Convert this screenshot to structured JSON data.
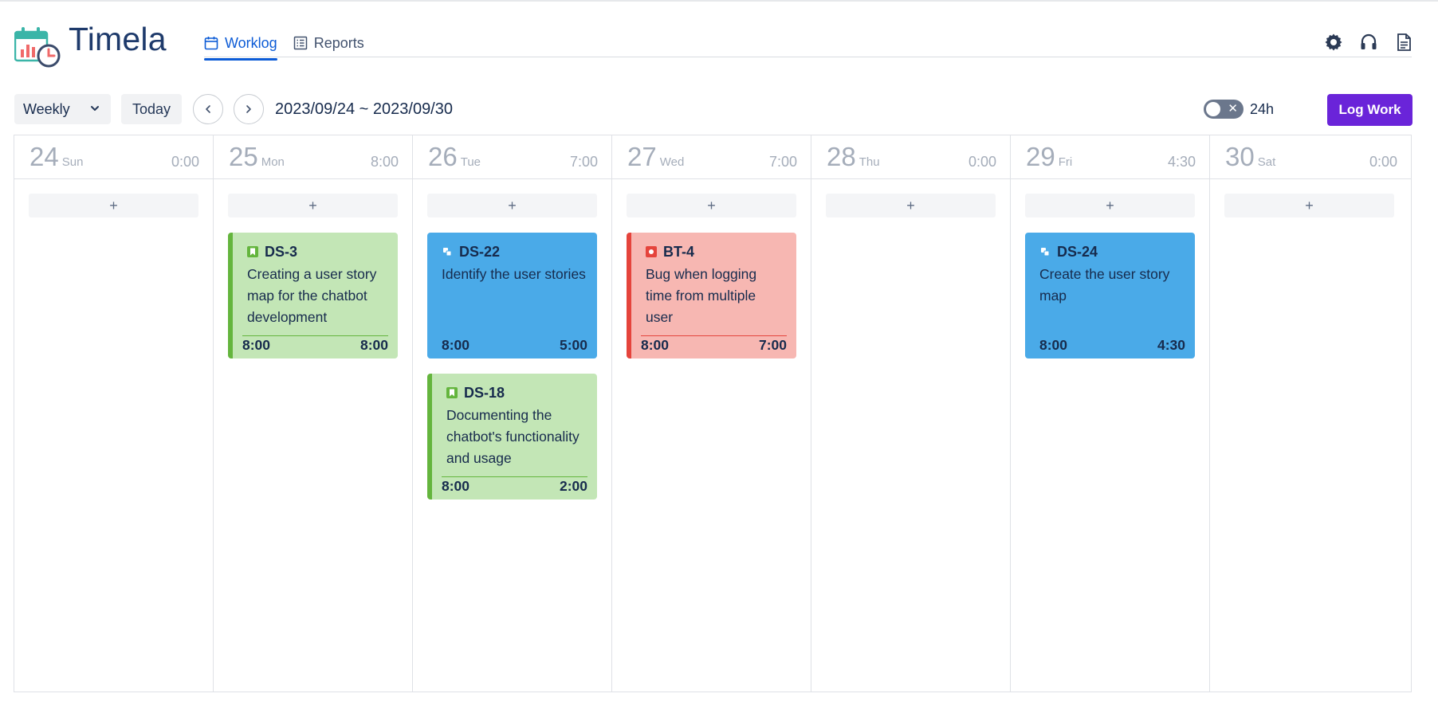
{
  "app": {
    "name": "Timela"
  },
  "nav": {
    "tabs": [
      {
        "label": "Worklog",
        "icon": "calendar-icon",
        "active": true
      },
      {
        "label": "Reports",
        "icon": "report-list-icon",
        "active": false
      }
    ]
  },
  "header_icons": [
    "gear-icon",
    "headset-icon",
    "document-icon"
  ],
  "toolbar": {
    "view_select": "Weekly",
    "today_label": "Today",
    "range": "2023/09/24 ~ 2023/09/30",
    "toggle_label": "24h",
    "toggle_on": false,
    "log_work_label": "Log Work"
  },
  "colors": {
    "accent": "#6a24d9",
    "nav_active": "#0c5bd6",
    "story_bg": "#c3e6b6",
    "story_border": "#64b53d",
    "subtask_bg": "#4aaae8",
    "bug_bg": "#f7b7b2",
    "bug_border": "#e5443c"
  },
  "days": [
    {
      "num": "24",
      "name": "Sun",
      "total": "0:00",
      "add": "+"
    },
    {
      "num": "25",
      "name": "Mon",
      "total": "8:00",
      "add": "+"
    },
    {
      "num": "26",
      "name": "Tue",
      "total": "7:00",
      "add": "+"
    },
    {
      "num": "27",
      "name": "Wed",
      "total": "7:00",
      "add": "+"
    },
    {
      "num": "28",
      "name": "Thu",
      "total": "0:00",
      "add": "+"
    },
    {
      "num": "29",
      "name": "Fri",
      "total": "4:30",
      "add": "+"
    },
    {
      "num": "30",
      "name": "Sat",
      "total": "0:00",
      "add": "+"
    }
  ],
  "worklogs": {
    "ds3": {
      "key": "DS-3",
      "type": "story",
      "type_icon": "bookmark-icon",
      "title": "Creating a user story map for the chatbot development",
      "start": "8:00",
      "duration": "8:00"
    },
    "ds22": {
      "key": "DS-22",
      "type": "subtask",
      "type_icon": "subtask-icon",
      "title": "Identify the user stories",
      "start": "8:00",
      "duration": "5:00"
    },
    "ds18": {
      "key": "DS-18",
      "type": "story",
      "type_icon": "bookmark-icon",
      "title": "Documenting the chatbot's functionality and usage",
      "start": "8:00",
      "duration": "2:00"
    },
    "bt4": {
      "key": "BT-4",
      "type": "bug",
      "type_icon": "bug-icon",
      "title": "Bug when logging time from multiple user",
      "start": "8:00",
      "duration": "7:00"
    },
    "ds24": {
      "key": "DS-24",
      "type": "subtask",
      "type_icon": "subtask-icon",
      "title": "Create the user story map",
      "start": "8:00",
      "duration": "4:30"
    }
  }
}
